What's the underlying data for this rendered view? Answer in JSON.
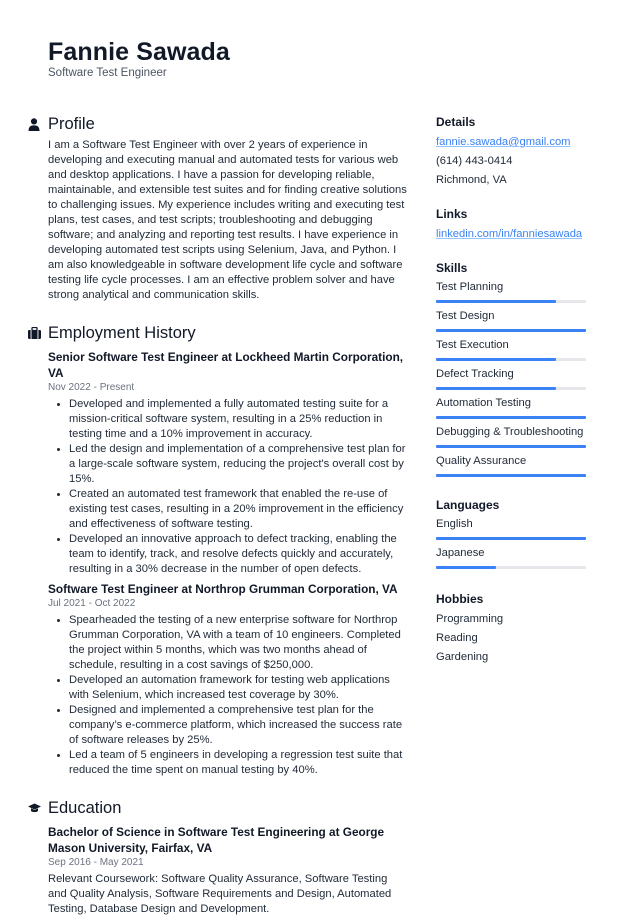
{
  "header": {
    "name": "Fannie Sawada",
    "role": "Software Test Engineer"
  },
  "profile": {
    "title": "Profile",
    "icon": "person-icon",
    "text": "I am a Software Test Engineer with over 2 years of experience in developing and executing manual and automated tests for various web and desktop applications. I have a passion for developing reliable, maintainable, and extensible test suites and for finding creative solutions to challenging issues. My experience includes writing and executing test plans, test cases, and test scripts; troubleshooting and debugging software; and analyzing and reporting test results. I have experience in developing automated test scripts using Selenium, Java, and Python. I am also knowledgeable in software development life cycle and software testing life cycle processes. I am an effective problem solver and have strong analytical and communication skills."
  },
  "employment": {
    "title": "Employment History",
    "icon": "briefcase-icon",
    "jobs": [
      {
        "title": "Senior Software Test Engineer at Lockheed Martin Corporation, VA",
        "date": "Nov 2022 - Present",
        "bullets": [
          "Developed and implemented a fully automated testing suite for a mission-critical software system, resulting in a 25% reduction in testing time and a 10% improvement in accuracy.",
          "Led the design and implementation of a comprehensive test plan for a large-scale software system, reducing the project's overall cost by 15%.",
          "Created an automated test framework that enabled the re-use of existing test cases, resulting in a 20% improvement in the efficiency and effectiveness of software testing.",
          "Developed an innovative approach to defect tracking, enabling the team to identify, track, and resolve defects quickly and accurately, resulting in a 30% decrease in the number of open defects."
        ]
      },
      {
        "title": "Software Test Engineer at Northrop Grumman Corporation, VA",
        "date": "Jul 2021 - Oct 2022",
        "bullets": [
          "Spearheaded the testing of a new enterprise software for Northrop Grumman Corporation, VA with a team of 10 engineers. Completed the project within 5 months, which was two months ahead of schedule, resulting in a cost savings of $250,000.",
          "Developed an automation framework for testing web applications with Selenium, which increased test coverage by 30%.",
          "Designed and implemented a comprehensive test plan for the company’s e-commerce platform, which increased the success rate of software releases by 25%.",
          "Led a team of 5 engineers in developing a regression test suite that reduced the time spent on manual testing by 40%."
        ]
      }
    ]
  },
  "education": {
    "title": "Education",
    "icon": "graduation-cap-icon",
    "degree": "Bachelor of Science in Software Test Engineering at George Mason University, Fairfax, VA",
    "date": "Sep 2016 - May 2021",
    "description": "Relevant Coursework: Software Quality Assurance, Software Testing and Quality Analysis, Software Requirements and Design, Automated Testing, Database Design and Development."
  },
  "details": {
    "title": "Details",
    "email": "fannie.sawada@gmail.com",
    "phone": "(614) 443-0414",
    "location": "Richmond, VA"
  },
  "links": {
    "title": "Links",
    "items": [
      "linkedin.com/in/fanniesawada"
    ]
  },
  "skills": {
    "title": "Skills",
    "items": [
      {
        "label": "Test Planning",
        "level": 0.8
      },
      {
        "label": "Test Design",
        "level": 1.0
      },
      {
        "label": "Test Execution",
        "level": 0.8
      },
      {
        "label": "Defect Tracking",
        "level": 0.8
      },
      {
        "label": "Automation Testing",
        "level": 1.0
      },
      {
        "label": "Debugging & Troubleshooting",
        "level": 1.0
      },
      {
        "label": "Quality Assurance",
        "level": 1.0
      }
    ]
  },
  "languages": {
    "title": "Languages",
    "items": [
      {
        "label": "English",
        "level": 1.0
      },
      {
        "label": "Japanese",
        "level": 0.4
      }
    ]
  },
  "hobbies": {
    "title": "Hobbies",
    "items": [
      "Programming",
      "Reading",
      "Gardening"
    ]
  },
  "colors": {
    "accent": "#3b82f6",
    "track": "#e5e7eb",
    "text": "#1f2937",
    "muted": "#6b7280"
  }
}
